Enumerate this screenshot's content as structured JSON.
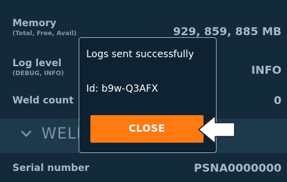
{
  "rows": {
    "memory": {
      "label": "Memory",
      "sublabel": "(Total, Free, Avail)",
      "value": "929, 859, 885 MB"
    },
    "log_level": {
      "label": "Log level",
      "sublabel": "(DEBUG, INFO)",
      "value": "INFO"
    },
    "weld_count": {
      "label": "Weld count",
      "value": "0"
    },
    "serial_number": {
      "label": "Serial number",
      "value": "PSNA0000000"
    }
  },
  "section": {
    "title": "WELD",
    "icon": "chevron-down-icon"
  },
  "dialog": {
    "message": "Logs sent successfully",
    "id_text": "Id: b9w-Q3AFX",
    "close_label": "CLOSE"
  },
  "pointer": {
    "icon": "arrow-left-icon"
  },
  "colors": {
    "background": "#132a3a",
    "section_header": "#1d3a4d",
    "dialog_background": "#0f2231",
    "accent": "#ff7a12",
    "text": "#a9b8c6"
  }
}
